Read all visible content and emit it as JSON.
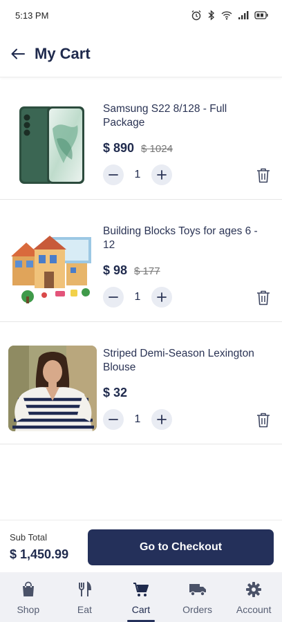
{
  "status_bar": {
    "time": "5:13 PM",
    "icons": [
      "alarm-icon",
      "bluetooth-icon",
      "wifi-icon",
      "signal-icon",
      "battery-icon"
    ]
  },
  "header": {
    "title": "My Cart",
    "back_icon": "arrow-left-icon"
  },
  "cart": {
    "items": [
      {
        "name": "Samsung S22 8/128 - Full Package",
        "price": "$ 890",
        "old_price": "$ 1024",
        "quantity": "1",
        "image": "phone-image"
      },
      {
        "name": "Building Blocks Toys for ages 6 - 12",
        "price": "$ 98",
        "old_price": "$ 177",
        "quantity": "1",
        "image": "toy-blocks-image"
      },
      {
        "name": "Striped Demi-Season Lexington Blouse",
        "price": "$ 32",
        "old_price": "",
        "quantity": "1",
        "image": "blouse-image"
      }
    ]
  },
  "checkout": {
    "subtotal_label": "Sub Total",
    "subtotal_value": "$ 1,450.99",
    "button_label": "Go to Checkout"
  },
  "nav": {
    "items": [
      {
        "label": "Shop",
        "icon": "shopping-bag-icon"
      },
      {
        "label": "Eat",
        "icon": "fork-knife-icon"
      },
      {
        "label": "Cart",
        "icon": "cart-icon",
        "active": true
      },
      {
        "label": "Orders",
        "icon": "truck-icon"
      },
      {
        "label": "Account",
        "icon": "gear-icon"
      }
    ]
  },
  "colors": {
    "primary": "#24305a",
    "text": "#1f2a4d",
    "nav_bg": "#f0f1f5",
    "qty_bg": "#e9ecf3"
  }
}
